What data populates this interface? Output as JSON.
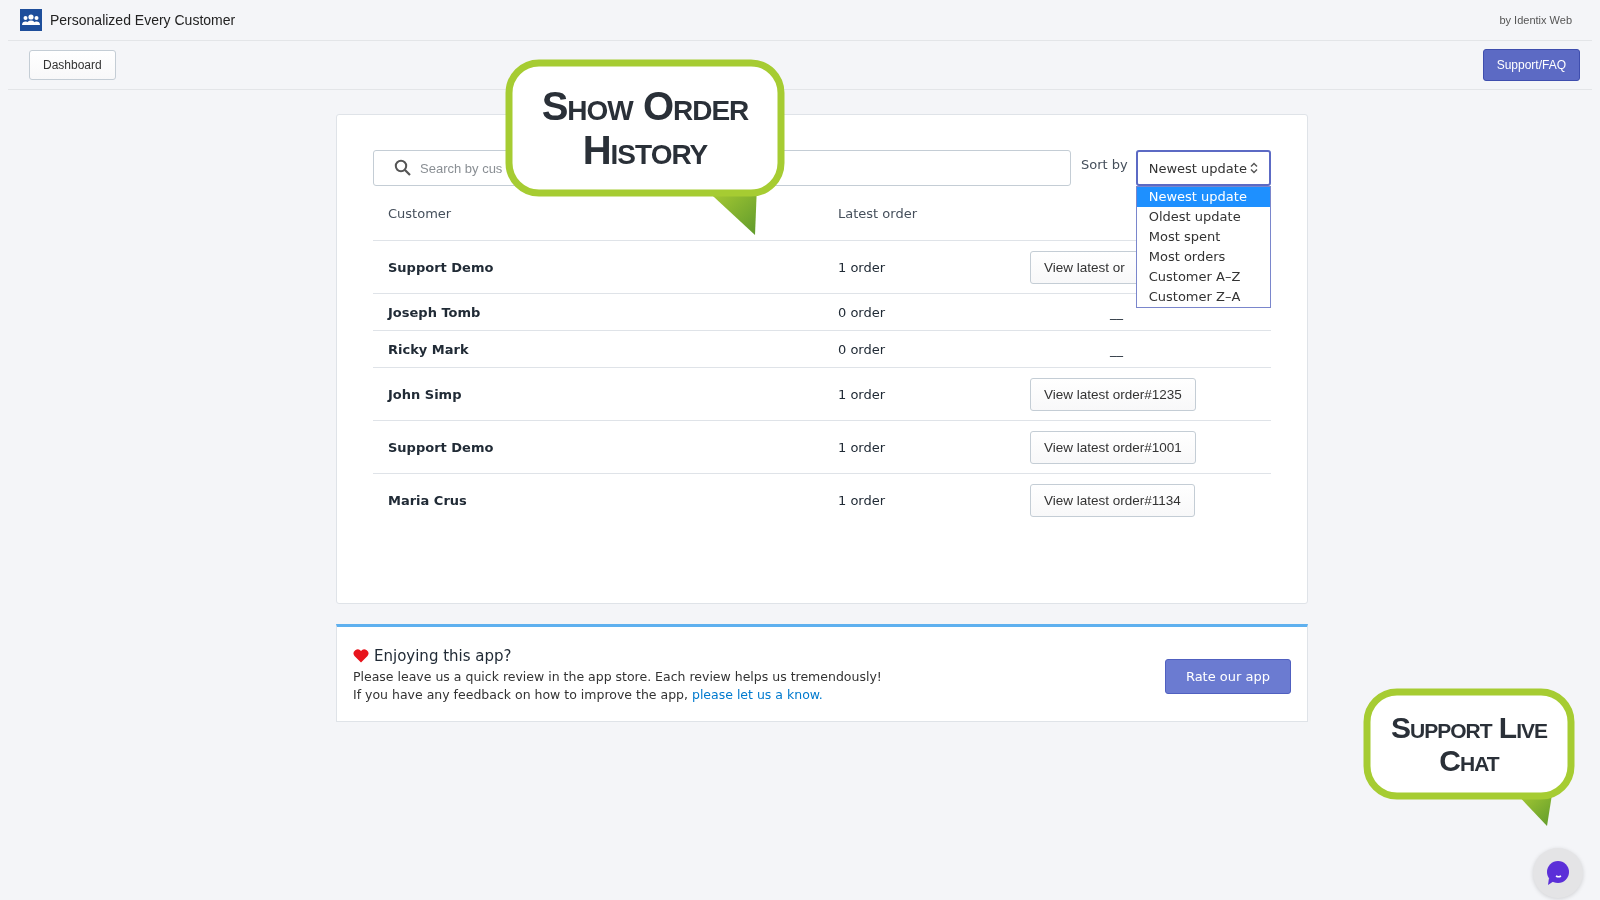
{
  "app_title": "Personalized Every Customer",
  "byline": "by Identix Web",
  "toolbar": {
    "dashboard": "Dashboard",
    "support": "Support/FAQ"
  },
  "search": {
    "placeholder": "Search by cus"
  },
  "sort": {
    "label": "Sort by",
    "value": "Newest update",
    "options": [
      {
        "label": "Newest update",
        "selected": true
      },
      {
        "label": "Oldest update",
        "selected": false
      },
      {
        "label": "Most spent",
        "selected": false
      },
      {
        "label": "Most orders",
        "selected": false
      },
      {
        "label": "Customer A–Z",
        "selected": false
      },
      {
        "label": "Customer Z–A",
        "selected": false
      }
    ]
  },
  "table": {
    "columns": [
      "Customer",
      "Latest order"
    ],
    "rows": [
      {
        "customer": "Support Demo",
        "latest_order": "1 order",
        "action": "View latest or"
      },
      {
        "customer": "Joseph Tomb",
        "latest_order": "0 order",
        "action": null,
        "empty": "__"
      },
      {
        "customer": "Ricky Mark",
        "latest_order": "0 order",
        "action": null,
        "empty": "__"
      },
      {
        "customer": "John Simp",
        "latest_order": "1 order",
        "action": "View latest order#1235"
      },
      {
        "customer": "Support Demo",
        "latest_order": "1 order",
        "action": "View latest order#1001"
      },
      {
        "customer": "Maria Crus",
        "latest_order": "1 order",
        "action": "View latest order#1134"
      }
    ]
  },
  "review": {
    "heading": "Enjoying this app?",
    "line_1": "Please leave us a quick review in the app store. Each review helps us tremendously!",
    "line_2": "If you have any feedback on how to improve the app,",
    "link": "please let us a know.",
    "button": "Rate our app"
  },
  "callouts": [
    {
      "text": "Show Order History",
      "kind": "top"
    },
    {
      "text": "Support Live Chat",
      "kind": "corner"
    }
  ]
}
